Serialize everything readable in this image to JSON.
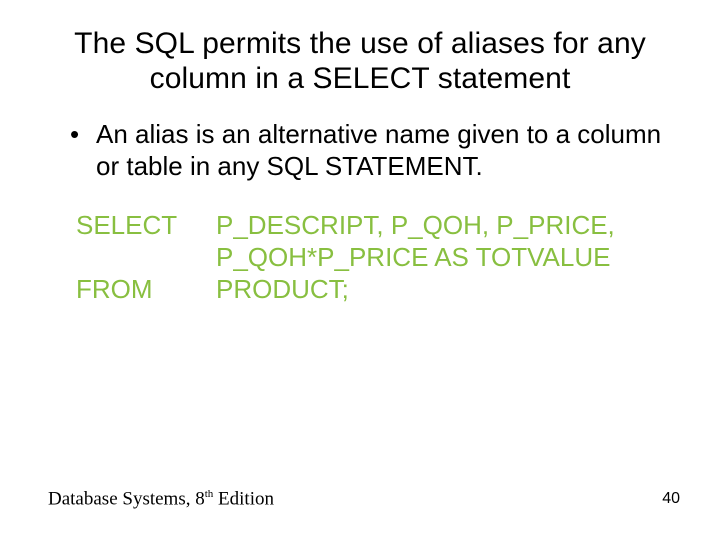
{
  "title": "The SQL permits the use of aliases for any column in a SELECT statement",
  "bullet": "An alias is an alternative name given to a column or table in any SQL STATEMENT.",
  "sql": {
    "select_kw": "SELECT",
    "select_clause_l1": "P_DESCRIPT, P_QOH, P_PRICE,",
    "select_clause_l2": "P_QOH*P_PRICE AS TOTVALUE",
    "from_kw": "FROM",
    "from_clause": "PRODUCT;"
  },
  "footer": {
    "book_prefix": "Database Systems, 8",
    "book_sup": "th",
    "book_suffix": " Edition",
    "page": "40"
  }
}
